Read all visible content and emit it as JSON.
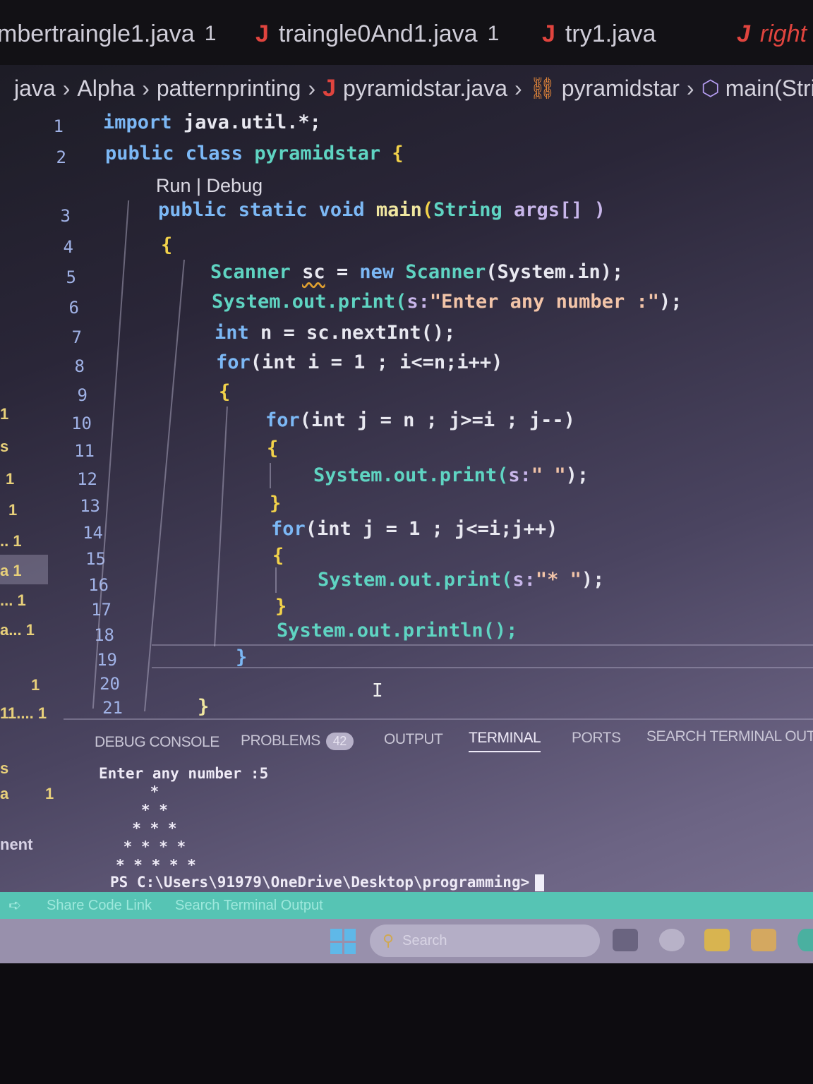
{
  "tabs": [
    {
      "label": "mbertraingle1.java",
      "count": "1"
    },
    {
      "label": "traingle0And1.java",
      "count": "1"
    },
    {
      "label": "try1.java",
      "count": ""
    },
    {
      "label": "right",
      "count": ""
    }
  ],
  "breadcrumb": [
    "java",
    "Alpha",
    "patternprinting",
    "pyramidstar.java",
    "pyramidstar",
    "main(Stri"
  ],
  "editor": {
    "line_numbers": [
      "1",
      "2",
      "3",
      "4",
      "5",
      "6",
      "7",
      "8",
      "9",
      "10",
      "11",
      "12",
      "13",
      "14",
      "15",
      "16",
      "17",
      "18",
      "19",
      "20",
      "21"
    ],
    "codelens": "Run | Debug",
    "code": {
      "l1": {
        "kw": "import",
        "rest": "java.util.*;"
      },
      "l2": {
        "kw": "public class",
        "name": "pyramidstar",
        "brace": "{"
      },
      "l3": {
        "kw": "public static void",
        "fn": "main",
        "open": "(",
        "ty": "String",
        "arg": "args[]",
        "close": " )"
      },
      "l4": "{",
      "l5": {
        "ty": "Scanner",
        "var": "sc",
        "eq": " = ",
        "kw": "new",
        "ty2": "Scanner",
        "rest": "(System.in);"
      },
      "l6": {
        "a": "System.out.print(",
        "p": "s:",
        "s": "\"Enter any number :\"",
        "e": ");"
      },
      "l7": {
        "kw": "int",
        "rest": " n = sc.nextInt();"
      },
      "l8": {
        "kw": "for",
        "rest": "(int i = 1 ; i<=n;i++)"
      },
      "l9": "{",
      "l10": {
        "kw": "for",
        "rest": "(int j = n ; j>=i ; j--)"
      },
      "l11": "{",
      "l12": {
        "a": "System.out.print(",
        "p": "s:",
        "s": "\" \"",
        "e": ");"
      },
      "l13": "}",
      "l14": {
        "kw": "for",
        "rest": "(int j = 1 ; j<=i;j++)"
      },
      "l15": "{",
      "l16": {
        "a": "System.out.print(",
        "p": "s:",
        "s": "\"* \"",
        "e": ");"
      },
      "l17": "}",
      "l18": "System.out.println();",
      "l19": "}",
      "l21": "}"
    }
  },
  "sidebar": {
    "items": [
      "1",
      "s",
      "1",
      "1",
      ".. 1",
      "a 1",
      "... 1",
      "a... 1",
      "1",
      "11.... 1",
      "s",
      "a",
      "1",
      "nent"
    ]
  },
  "panel": {
    "tabs": [
      "DEBUG CONSOLE",
      "PROBLEMS",
      "OUTPUT",
      "TERMINAL",
      "PORTS",
      "SEARCH TERMINAL OUTP"
    ],
    "problems_count": "42",
    "active_tab": "TERMINAL",
    "terminal_lines": [
      "Enter any number :5",
      "    *",
      "   * *",
      "  * * *",
      " * * * *",
      "* * * * *"
    ],
    "prompt": "PS C:\\Users\\91979\\OneDrive\\Desktop\\programming>"
  },
  "statusbar": {
    "share": "Share Code Link",
    "search": "Search Terminal Output"
  },
  "taskbar": {
    "search_placeholder": "Search"
  },
  "colors": {
    "keyword": "#7cb8f5",
    "type": "#5fd4c2",
    "string": "#f2c4a8",
    "statusbar": "#56c4b4",
    "java_icon": "#e0443e"
  }
}
